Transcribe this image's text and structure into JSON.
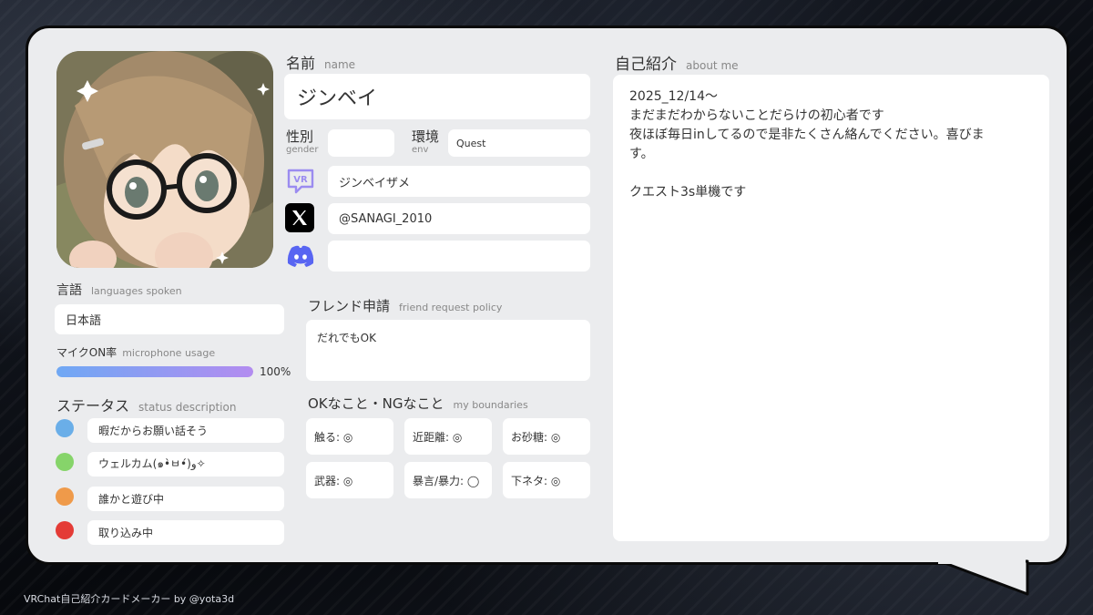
{
  "name": {
    "label": "名前",
    "sub": "name",
    "value": "ジンベイ"
  },
  "gender": {
    "label": "性別",
    "sub": "gender",
    "value": ""
  },
  "env": {
    "label": "環境",
    "sub": "env",
    "value": "Quest"
  },
  "vrchat": {
    "icon": "vrchat-icon",
    "value": "ジンベイザメ"
  },
  "x": {
    "icon": "x-logo-icon",
    "value": "@SANAGI_2010"
  },
  "discord": {
    "icon": "discord-icon",
    "value": ""
  },
  "languages": {
    "label": "言語",
    "sub": "languages spoken",
    "value": "日本語"
  },
  "mic": {
    "label": "マイクON率",
    "sub": "microphone usage",
    "percent": 100,
    "percent_text": "100%"
  },
  "status": {
    "label": "ステータス",
    "sub": "status description",
    "items": [
      {
        "color": "#6aaee8",
        "text": "暇だからお願い話そう"
      },
      {
        "color": "#86d46a",
        "text": "ウェルカム(๑•̀ㅂ•́)و✧"
      },
      {
        "color": "#ef9a4a",
        "text": "誰かと遊び中"
      },
      {
        "color": "#e43b36",
        "text": "取り込み中"
      }
    ]
  },
  "friend": {
    "label": "フレンド申請",
    "sub": "friend request policy",
    "value": "だれでもOK"
  },
  "boundaries": {
    "label": "OKなこと・NGなこと",
    "sub": "my boundaries",
    "items": [
      "触る: ◎",
      "近距離: ◎",
      "お砂糖: ◎",
      "武器: ◎",
      "暴言/暴力: ◯",
      "下ネタ: ◎"
    ]
  },
  "about": {
    "label": "自己紹介",
    "sub": "about me",
    "lines": [
      "2025_12/14〜",
      "まだまだわからないことだらけの初心者です",
      "夜ほぼ毎日inしてるので是非たくさん絡んでください。喜びま",
      "す。",
      "",
      "クエスト3s単機です"
    ]
  },
  "footer": "VRChat自己紹介カードメーカー by @yota3d"
}
